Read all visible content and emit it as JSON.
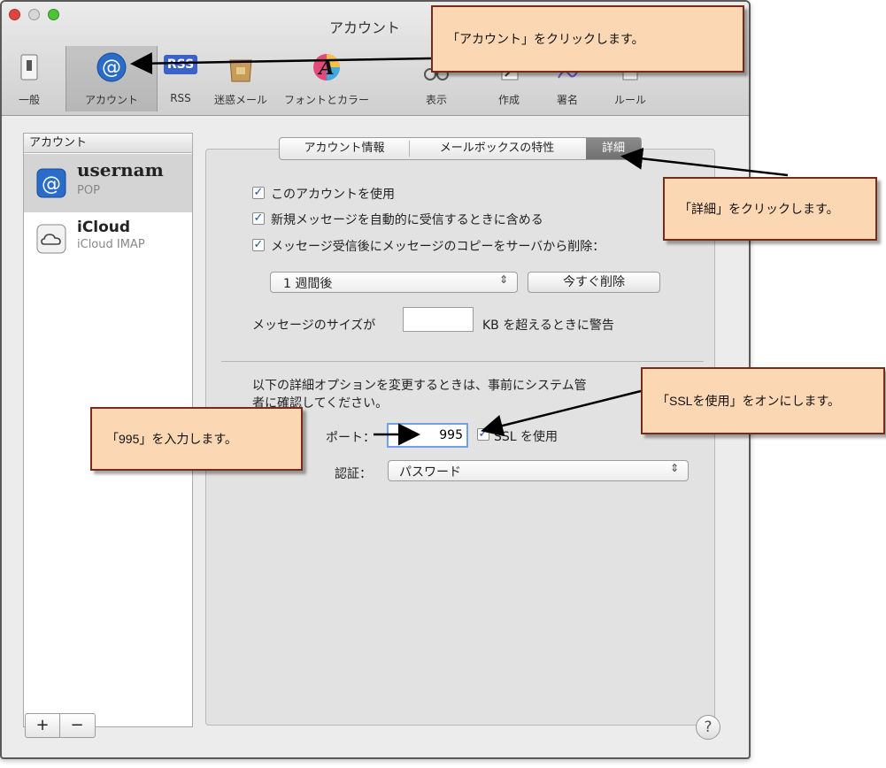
{
  "window": {
    "title": "アカウント"
  },
  "toolbar": {
    "items": [
      {
        "label": "一般",
        "icon": "switch-icon"
      },
      {
        "label": "アカウント",
        "icon": "at-sign-icon"
      },
      {
        "label": "RSS",
        "icon": "rss-icon"
      },
      {
        "label": "迷惑メール",
        "icon": "junk-bag-icon"
      },
      {
        "label": "フォントとカラー",
        "icon": "font-palette-icon"
      },
      {
        "label": "表示",
        "icon": "glasses-icon"
      },
      {
        "label": "作成",
        "icon": "pen-icon"
      },
      {
        "label": "署名",
        "icon": "signature-icon"
      },
      {
        "label": "ルール",
        "icon": "rules-icon"
      }
    ],
    "rss_badge": "RSS",
    "font_glyph": "A"
  },
  "accounts": {
    "header": "アカウント",
    "items": [
      {
        "name": "usernam",
        "type": "POP"
      },
      {
        "name": "iCloud",
        "type": "iCloud IMAP"
      }
    ]
  },
  "tabs": [
    {
      "label": "アカウント情報"
    },
    {
      "label": "メールボックスの特性"
    },
    {
      "label": "詳細"
    }
  ],
  "options": {
    "enable_account": "このアカウントを使用",
    "include_auto_check": "新規メッセージを自動的に受信するときに含める",
    "remove_copy": "メッセージ受信後にメッセージのコピーをサーバから削除：",
    "remove_after_value": "1 週間後",
    "remove_now_label": "今すぐ削除",
    "size_warning_prefix": "メッセージのサイズが",
    "size_warning_value": "",
    "size_warning_suffix": "KB を超えるときに警告"
  },
  "advanced": {
    "note_line1": "以下の詳細オプションを変更するときは、事前にシステム管",
    "note_line2": "者に確認してください。",
    "port_label": "ポート：",
    "port_value": "995",
    "ssl_label": "SSL を使用",
    "auth_label": "認証：",
    "auth_value": "パスワード"
  },
  "footer": {
    "plus": "+",
    "minus": "−",
    "help": "?"
  },
  "callouts": {
    "account": "「アカウント」をクリックします。",
    "details": "「詳細」をクリックします。",
    "ssl": "「SSLを使用」をオンにします。",
    "port": "「995」を入力します。"
  },
  "colors": {
    "callout_fill": "#fcd7b4",
    "callout_border": "#7a2a1a",
    "accent_blue": "#1d4fa8"
  }
}
